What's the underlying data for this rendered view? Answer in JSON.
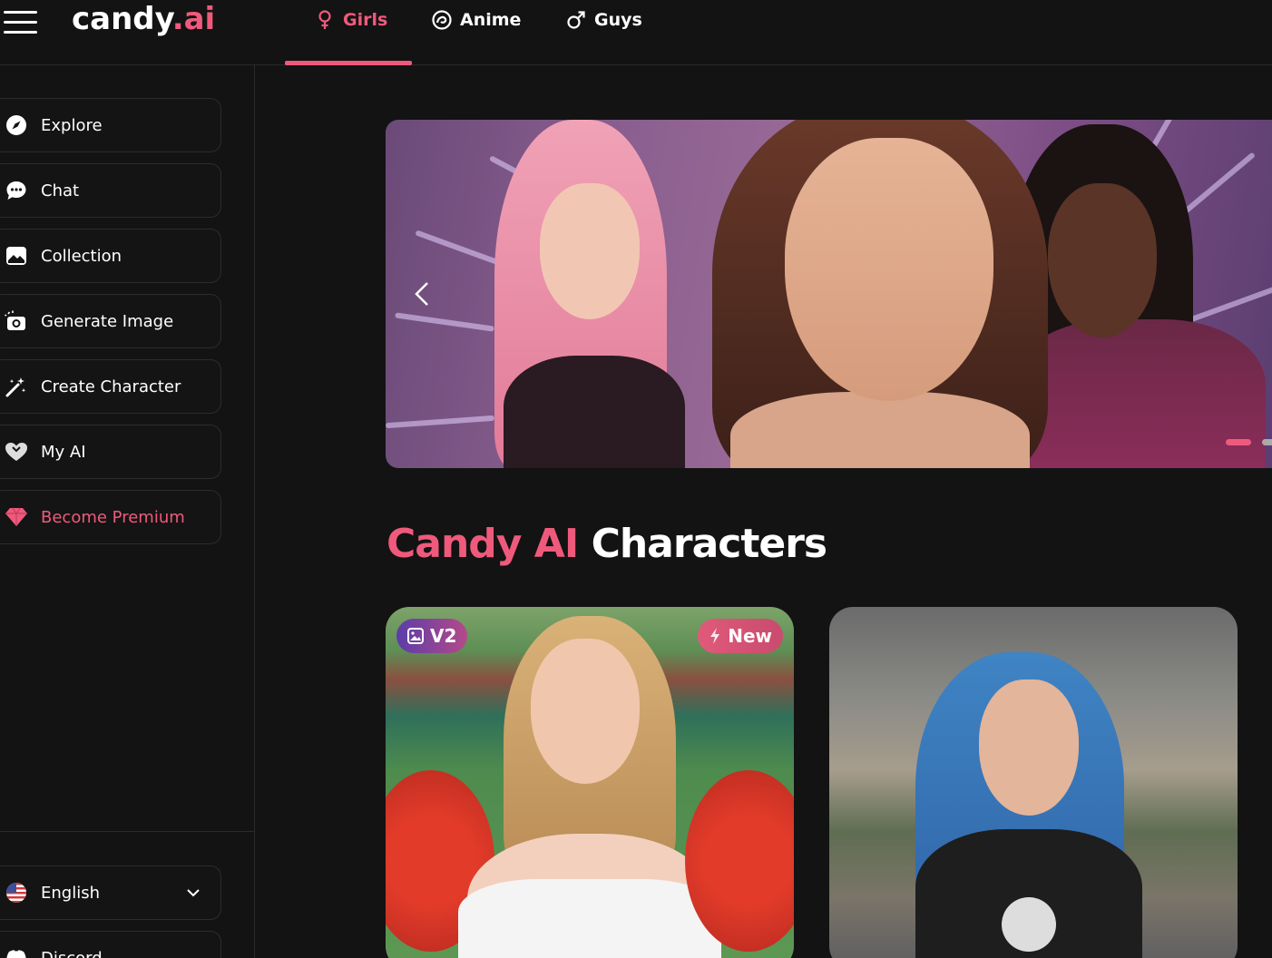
{
  "brand": {
    "logo_main": "candy",
    "logo_dot": ".",
    "logo_suffix": "ai"
  },
  "tabs": [
    {
      "label": "Girls",
      "icon": "female-icon",
      "active": true
    },
    {
      "label": "Anime",
      "icon": "anime-icon",
      "active": false
    },
    {
      "label": "Guys",
      "icon": "male-icon",
      "active": false
    }
  ],
  "sidebar": {
    "items": [
      {
        "label": "Explore",
        "icon": "compass-icon"
      },
      {
        "label": "Chat",
        "icon": "chat-icon"
      },
      {
        "label": "Collection",
        "icon": "gallery-icon"
      },
      {
        "label": "Generate Image",
        "icon": "camera-icon"
      },
      {
        "label": "Create Character",
        "icon": "magic-wand-icon"
      },
      {
        "label": "My AI",
        "icon": "heart-icon"
      },
      {
        "label": "Become Premium",
        "icon": "diamond-icon"
      }
    ],
    "language": {
      "label": "English",
      "icon": "us-flag-icon"
    },
    "discord": {
      "label": "Discord",
      "icon": "discord-icon"
    }
  },
  "banner": {
    "slides_total": 2,
    "active_slide": 1
  },
  "main": {
    "heading_pink": "Candy AI",
    "heading_white": "Characters"
  },
  "cards": [
    {
      "badge_left": "V2",
      "badge_right": "New"
    },
    {}
  ],
  "colors": {
    "accent": "#ef5a7c",
    "background": "#131313",
    "border": "#2c2c2c"
  }
}
